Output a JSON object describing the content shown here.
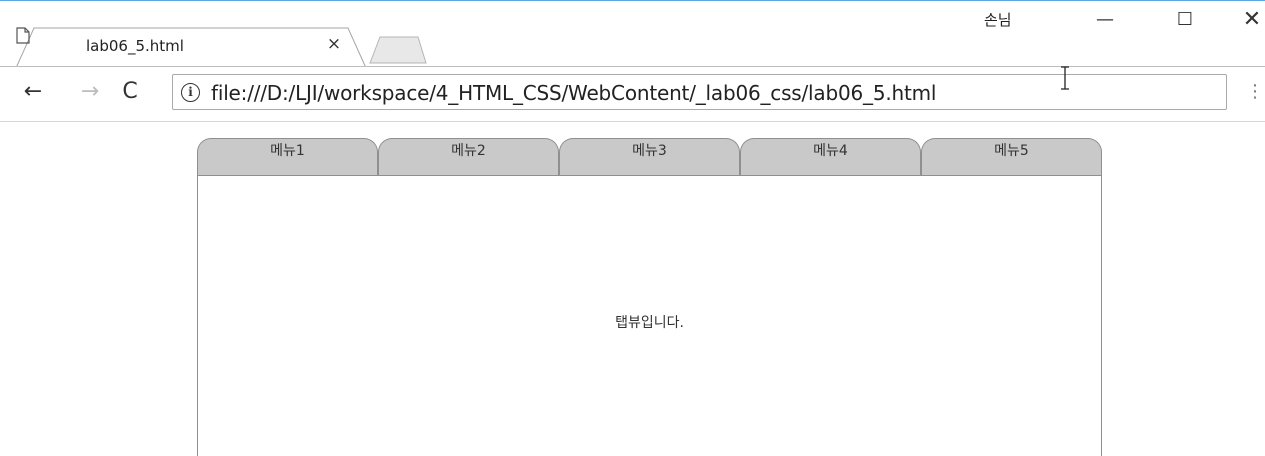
{
  "browser": {
    "tab_title": "lab06_5.html",
    "tab_close": "×",
    "profile_name": "손님",
    "window_controls": {
      "minimize": "—",
      "maximize": "☐",
      "close": "✕"
    },
    "nav": {
      "back": "←",
      "forward": "→",
      "reload": "C"
    },
    "info_icon": "i",
    "url": "file:///D:/LJI/workspace/4_HTML_CSS/WebContent/_lab06_css/lab06_5.html",
    "menu_icon": "⋮"
  },
  "page": {
    "menu_tabs": [
      {
        "label": "메뉴1"
      },
      {
        "label": "메뉴2"
      },
      {
        "label": "메뉴3"
      },
      {
        "label": "메뉴4"
      },
      {
        "label": "메뉴5"
      }
    ],
    "panel_text": "탭뷰입니다."
  },
  "colors": {
    "menu_tab_bg": "#c9c9c9",
    "border": "#8f8f8f",
    "titlebar_accent": "#5aa9e6"
  }
}
